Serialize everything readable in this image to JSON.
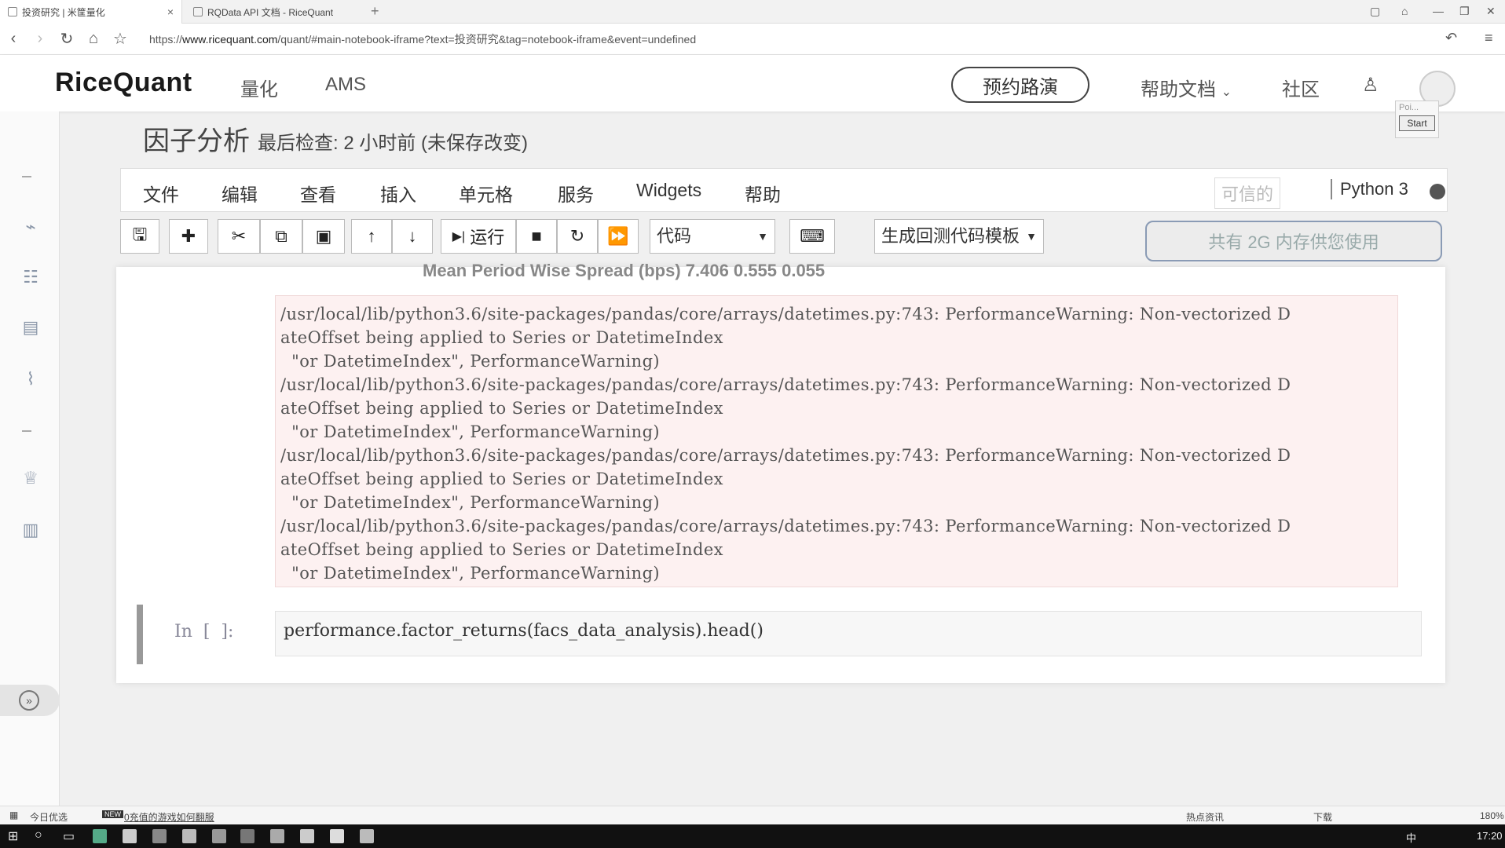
{
  "browser": {
    "tabs": [
      {
        "label": "投资研究 | 米筐量化",
        "active": true
      },
      {
        "label": "RQData API 文档 - RiceQuant",
        "active": false
      }
    ],
    "url_prefix": "https://",
    "url_host": "www.ricequant.com",
    "url_path": "/quant/#main-notebook-iframe?text=投资研究&tag=notebook-iframe&event=undefined"
  },
  "site": {
    "logo": "RiceQuant",
    "nav": [
      "量化",
      "AMS"
    ],
    "demo_button": "预约路演",
    "help_docs": "帮助文档",
    "community": "社区",
    "popup": {
      "poi": "Poi...",
      "start": "Start"
    }
  },
  "notebook": {
    "title": "因子分析",
    "checkpoint": "最后检查: 2 小时前  (未保存改变)",
    "menus": [
      "文件",
      "编辑",
      "查看",
      "插入",
      "单元格",
      "服务",
      "Widgets",
      "帮助"
    ],
    "trusted": "可信的",
    "kernel": "Python 3",
    "toolbar": {
      "run_label": "运行",
      "cell_type": "代码",
      "template": "生成回测代码模板",
      "memory": "共有 2G 内存供您使用"
    },
    "clipped_row": "Mean Period Wise Spread (bps)    7.406    0.555    0.055",
    "stderr_lines": [
      "/usr/local/lib/python3.6/site-packages/pandas/core/arrays/datetimes.py:743: PerformanceWarning: Non-vectorized D",
      "ateOffset being applied to Series or DatetimeIndex",
      "  \"or DatetimeIndex\", PerformanceWarning)",
      "/usr/local/lib/python3.6/site-packages/pandas/core/arrays/datetimes.py:743: PerformanceWarning: Non-vectorized D",
      "ateOffset being applied to Series or DatetimeIndex",
      "  \"or DatetimeIndex\", PerformanceWarning)",
      "/usr/local/lib/python3.6/site-packages/pandas/core/arrays/datetimes.py:743: PerformanceWarning: Non-vectorized D",
      "ateOffset being applied to Series or DatetimeIndex",
      "  \"or DatetimeIndex\", PerformanceWarning)",
      "/usr/local/lib/python3.6/site-packages/pandas/core/arrays/datetimes.py:743: PerformanceWarning: Non-vectorized D",
      "ateOffset being applied to Series or DatetimeIndex",
      "  \"or DatetimeIndex\", PerformanceWarning)"
    ],
    "input_prompt": "In  [  ]:",
    "input_code": "performance.factor_returns(facs_data_analysis).head()"
  },
  "status": {
    "left_label": "今日优选",
    "news": "0充值的游戏如何翻服",
    "hot_news": "热点资讯",
    "download": "下载",
    "zoom": "180%"
  },
  "taskbar": {
    "time": "17:20",
    "ime": "中"
  }
}
